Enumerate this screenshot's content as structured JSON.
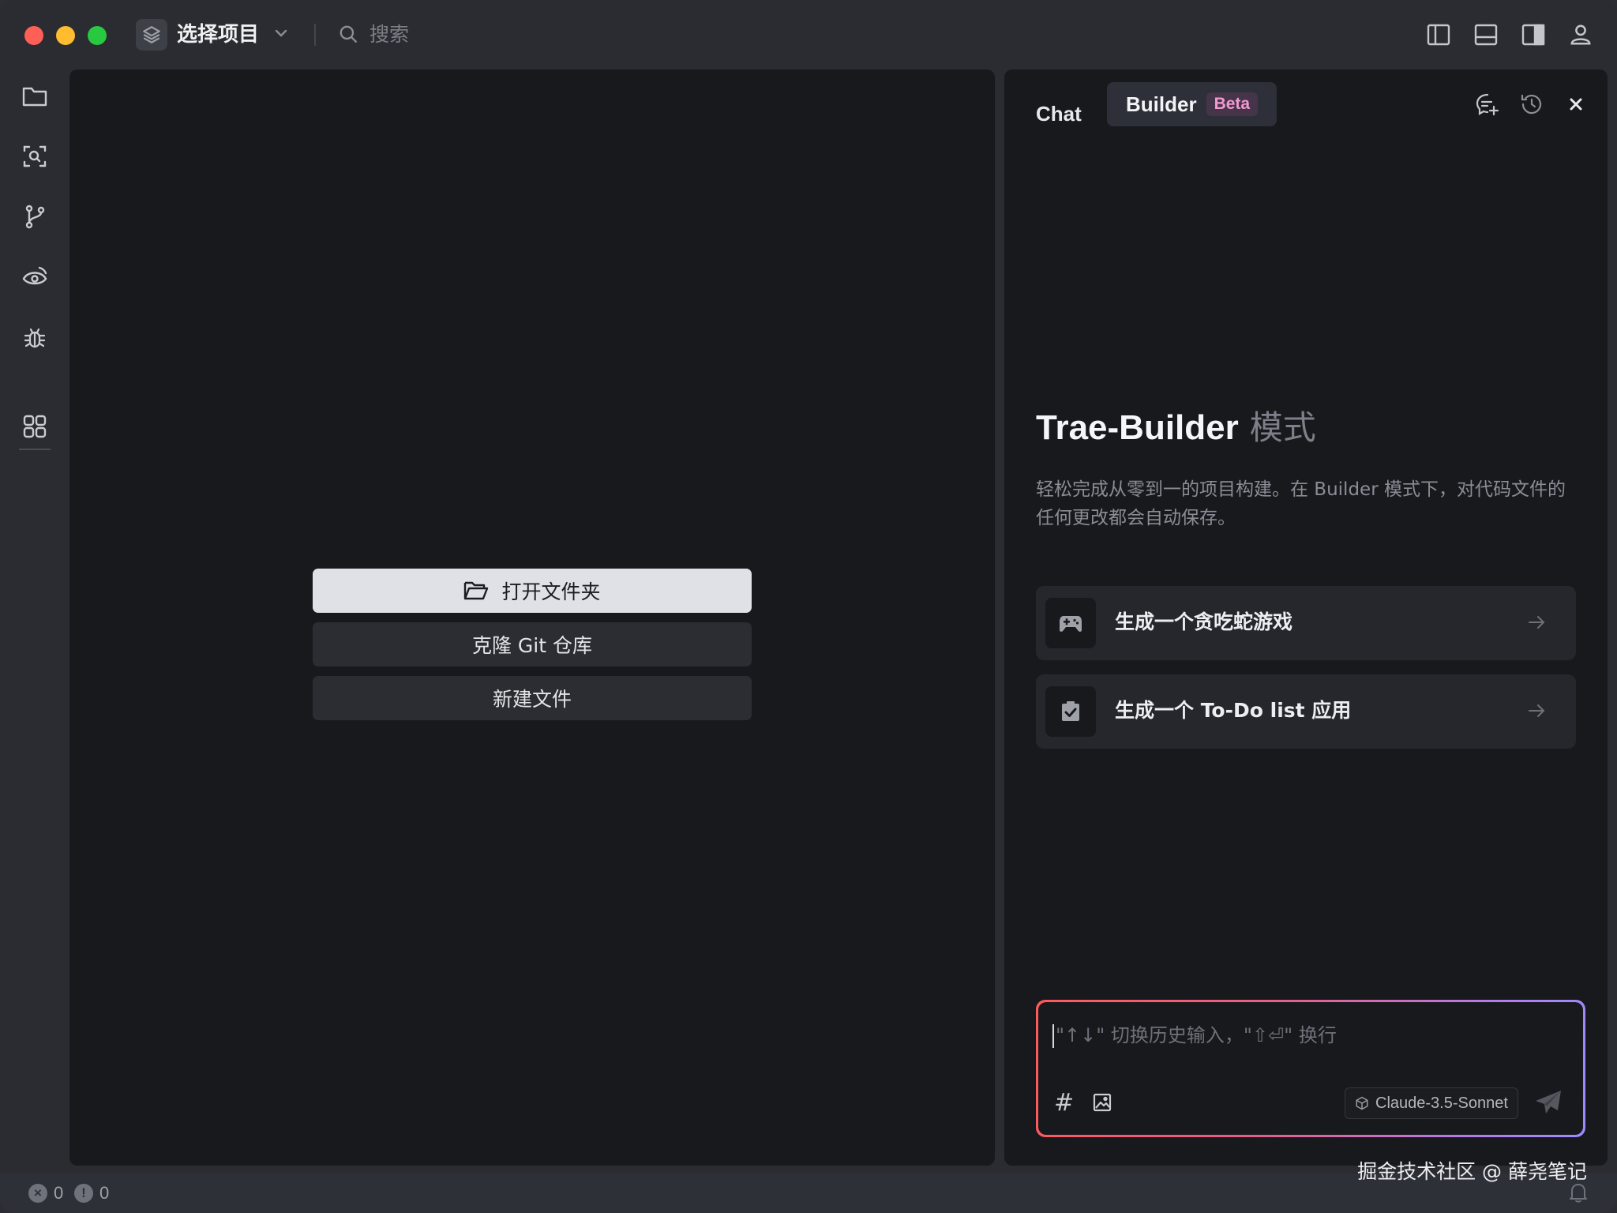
{
  "titlebar": {
    "project_label": "选择项目",
    "search_placeholder": "搜索"
  },
  "activity_bar": {
    "items": [
      "explorer-icon",
      "search-icon",
      "source-control-icon",
      "watch-icon",
      "debug-icon",
      "extensions-icon"
    ]
  },
  "editor": {
    "open_folder": "打开文件夹",
    "clone_git": "克隆 Git 仓库",
    "new_file": "新建文件"
  },
  "panel": {
    "tabs": [
      {
        "label": "Chat",
        "active": false
      },
      {
        "label": "Builder",
        "active": true,
        "badge": "Beta"
      }
    ],
    "hero": {
      "title": "Trae-Builder",
      "mode_label": "模式",
      "description": "轻松完成从零到一的项目构建。在 Builder 模式下，对代码文件的任何更改都会自动保存。"
    },
    "suggestions": [
      {
        "label": "生成一个贪吃蛇游戏",
        "icon": "gamepad-icon"
      },
      {
        "label": "生成一个 To-Do list 应用",
        "icon": "checklist-icon"
      }
    ],
    "input": {
      "placeholder": "\"↑↓\" 切换历史输入，\"⇧⏎\" 换行",
      "hash_symbol": "#",
      "model": "Claude-3.5-Sonnet"
    }
  },
  "statusbar": {
    "errors": "0",
    "warnings": "0"
  },
  "watermark": "掘金技术社区 @ 薛尧笔记",
  "colors": {
    "accent_gradient_start": "#ff5a5a",
    "accent_gradient_end": "#9a8cff",
    "beta_badge": "#f09ad0"
  }
}
